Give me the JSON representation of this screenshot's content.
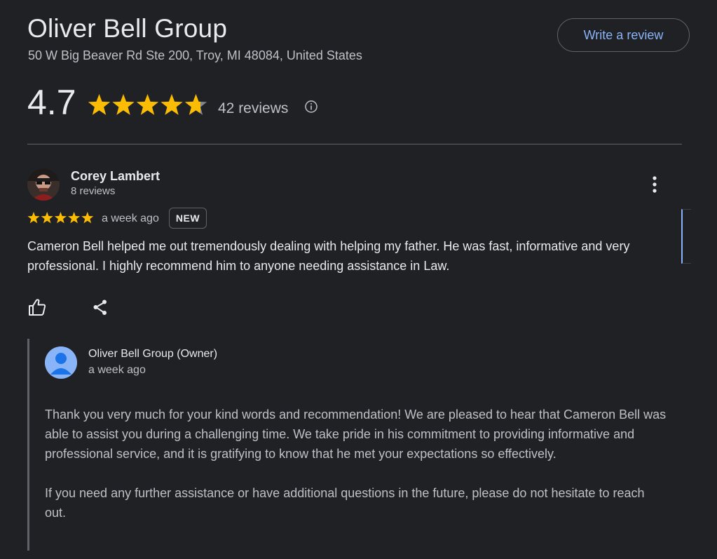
{
  "business": {
    "name": "Oliver Bell Group",
    "address": "50 W Big Beaver Rd Ste 200, Troy, MI 48084, United States",
    "write_review_label": "Write a review"
  },
  "rating": {
    "average": "4.7",
    "average_value": 4.7,
    "max_stars": 5,
    "review_count_label": "42 reviews"
  },
  "review": {
    "author": "Corey Lambert",
    "author_review_count": "8 reviews",
    "stars": 5,
    "time": "a week ago",
    "badge": "NEW",
    "text": "Cameron Bell helped me out tremendously dealing with helping my father. He was fast, informative and very professional. I highly recommend him to anyone needing assistance in Law."
  },
  "owner_reply": {
    "author": "Oliver Bell Group (Owner)",
    "time": "a week ago",
    "paragraph_1": "Thank you very much for your kind words and recommendation! We are pleased to hear that Cameron Bell was able to assist you during a challenging time. We take pride in his commitment to providing informative and professional service, and it is gratifying to know that he met your expectations so effectively.",
    "paragraph_2": "If you need any further assistance or have additional questions in the future, please do not hesitate to reach out."
  },
  "icons": {
    "info": "info-icon",
    "more": "more-vert-icon",
    "like": "thumbs-up-icon",
    "share": "share-icon",
    "star": "star-icon"
  },
  "colors": {
    "background": "#202124",
    "star": "#fbbc04",
    "star_empty": "#80868b",
    "link": "#8ab4f8",
    "owner_avatar": "#8ab4f8"
  }
}
